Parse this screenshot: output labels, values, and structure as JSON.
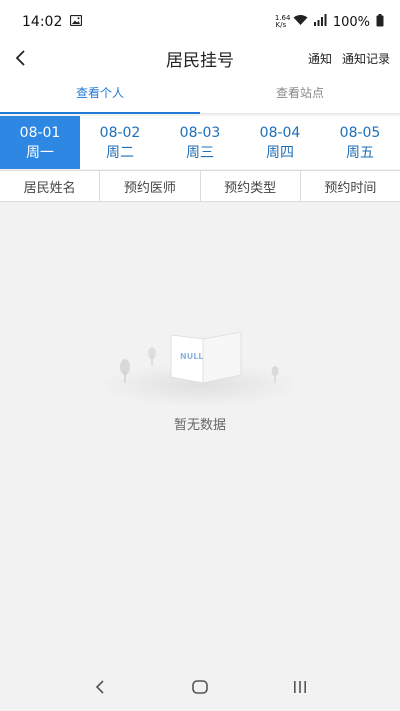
{
  "status": {
    "time": "14:02",
    "speed_top": "1.64",
    "speed_bottom": "K/s",
    "battery": "100%"
  },
  "header": {
    "title": "居民挂号",
    "notify_label": "通知",
    "notify_record_label": "通知记录"
  },
  "top_tabs": [
    {
      "label": "查看个人",
      "active": true
    },
    {
      "label": "查看站点",
      "active": false
    }
  ],
  "dates": [
    {
      "date": "08-01",
      "weekday": "周一",
      "active": true
    },
    {
      "date": "08-02",
      "weekday": "周二",
      "active": false
    },
    {
      "date": "08-03",
      "weekday": "周三",
      "active": false
    },
    {
      "date": "08-04",
      "weekday": "周四",
      "active": false
    },
    {
      "date": "08-05",
      "weekday": "周五",
      "active": false
    }
  ],
  "columns": [
    "居民姓名",
    "预约医师",
    "预约类型",
    "预约时间"
  ],
  "empty": {
    "illustration_text": "NULL",
    "message": "暂无数据"
  },
  "colors": {
    "accent": "#2d87e3",
    "tab_active": "#1f7ad6",
    "date_text": "#1f6fb8"
  }
}
